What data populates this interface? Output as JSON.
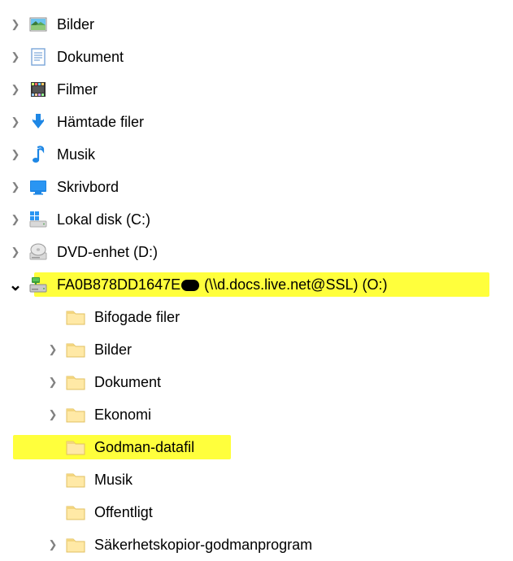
{
  "items": [
    {
      "label": "Bilder",
      "level": 0,
      "exp": "collapsed",
      "icon": "pictures"
    },
    {
      "label": "Dokument",
      "level": 0,
      "exp": "collapsed",
      "icon": "document"
    },
    {
      "label": "Filmer",
      "level": 0,
      "exp": "collapsed",
      "icon": "film"
    },
    {
      "label": "Hämtade filer",
      "level": 0,
      "exp": "collapsed",
      "icon": "download"
    },
    {
      "label": "Musik",
      "level": 0,
      "exp": "collapsed",
      "icon": "music"
    },
    {
      "label": "Skrivbord",
      "level": 0,
      "exp": "collapsed",
      "icon": "desktop"
    },
    {
      "label": "Lokal disk (C:)",
      "level": 0,
      "exp": "collapsed",
      "icon": "localdisk"
    },
    {
      "label": "DVD-enhet (D:)",
      "level": 0,
      "exp": "collapsed",
      "icon": "dvd"
    },
    {
      "label_pre": "FA0B878DD1647E",
      "label_post": " (\\\\d.docs.live.net@SSL) (O:)",
      "level": 0,
      "exp": "expanded",
      "icon": "netdrive",
      "highlight": "drive",
      "redacted": true
    },
    {
      "label": "Bifogade filer",
      "level": 1,
      "exp": "none",
      "icon": "folder"
    },
    {
      "label": "Bilder",
      "level": 1,
      "exp": "collapsed",
      "icon": "folder"
    },
    {
      "label": "Dokument",
      "level": 1,
      "exp": "collapsed",
      "icon": "folder"
    },
    {
      "label": "Ekonomi",
      "level": 1,
      "exp": "collapsed",
      "icon": "folder"
    },
    {
      "label": "Godman-datafil",
      "level": 1,
      "exp": "none",
      "icon": "folder",
      "highlight": "godman"
    },
    {
      "label": "Musik",
      "level": 1,
      "exp": "none",
      "icon": "folder"
    },
    {
      "label": "Offentligt",
      "level": 1,
      "exp": "none",
      "icon": "folder"
    },
    {
      "label": "Säkerhetskopior-godmanprogram",
      "level": 1,
      "exp": "collapsed",
      "icon": "folder"
    }
  ],
  "icon_glyphs": {
    "collapsed": "❯",
    "expanded": "⌄"
  }
}
